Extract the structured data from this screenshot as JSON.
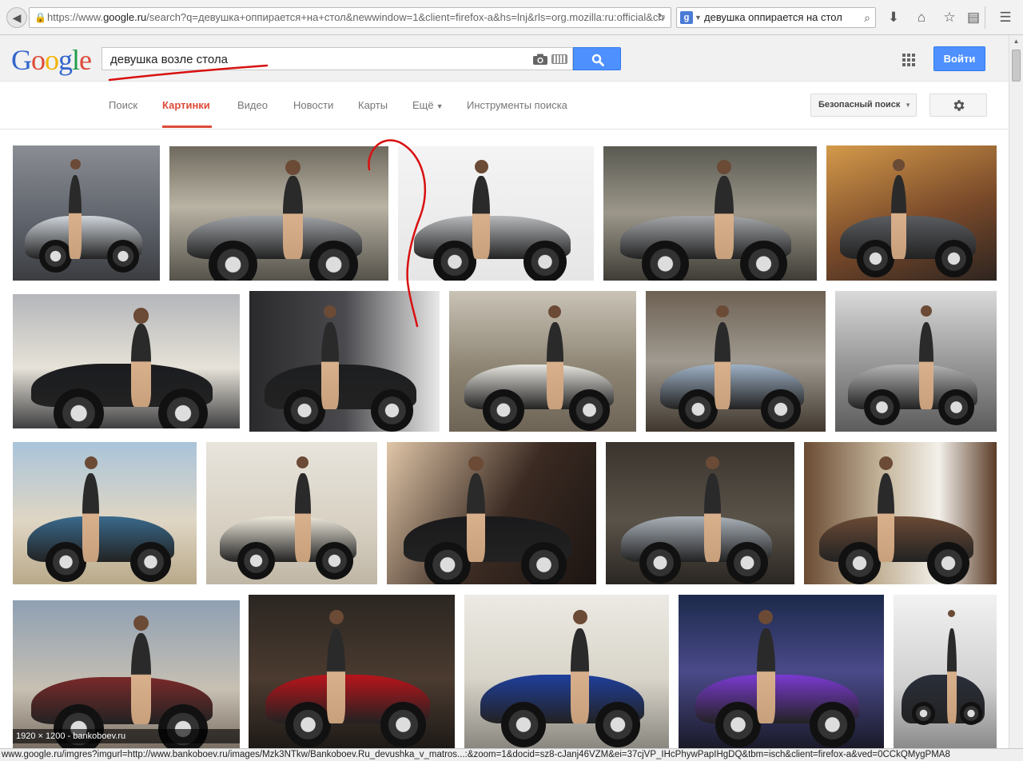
{
  "browser": {
    "url_prefix": "https://www.",
    "url_domain": "google.ru",
    "url_rest": "/search?q=девушка+оппирается+на+стол&newwindow=1&client=firefox-a&hs=lnj&rls=org.mozilla:ru:official&ch",
    "search_engine_query": "девушка оппирается на стол",
    "search_engine_badge": "g"
  },
  "header": {
    "logo_letters": [
      "G",
      "o",
      "o",
      "g",
      "l",
      "e"
    ],
    "logo_colors": [
      "#3366cc",
      "#dd4b39",
      "#f2b300",
      "#3366cc",
      "#1f9e49",
      "#dd4b39"
    ],
    "query": "девушка возле стола",
    "signin_label": "Войти"
  },
  "tabs": [
    {
      "label": "Поиск",
      "active": false
    },
    {
      "label": "Картинки",
      "active": true
    },
    {
      "label": "Видео",
      "active": false
    },
    {
      "label": "Новости",
      "active": false
    },
    {
      "label": "Карты",
      "active": false
    },
    {
      "label": "Ещё",
      "active": false,
      "dropdown": true
    },
    {
      "label": "Инструменты поиска",
      "active": false
    }
  ],
  "safe_search_label": "Безопасный поиск",
  "hover_caption": "1920 × 1200 - bankoboev.ru",
  "status_url": "www.google.ru/imgres?imgurl=http://www.bankoboev.ru/images/Mzk3NTkw/Bankoboev.Ru_devushka_v_matros...:&zoom=1&docid=sz8-cJanj46VZM&ei=37cjVP_IHcPhywPapIHgDQ&tbm=isch&client=firefox-a&ved=0CCkQMygPMA8",
  "colors": {
    "accent_blue": "#4d90fe",
    "active_tab_red": "#dd4b39",
    "annotation_red": "#d81010"
  }
}
